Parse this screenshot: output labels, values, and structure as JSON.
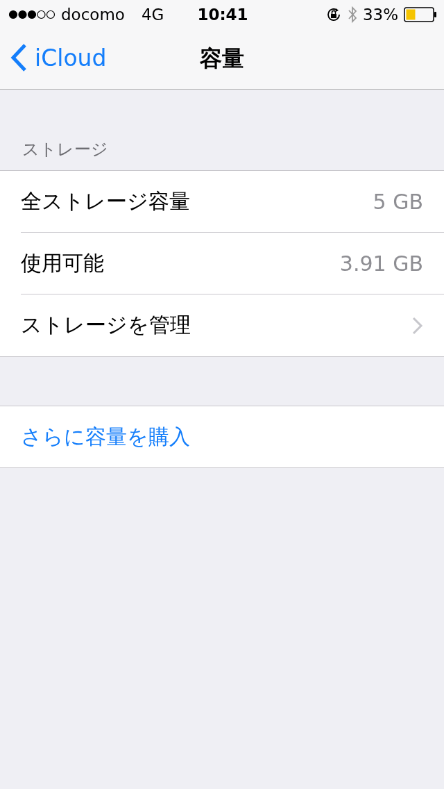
{
  "status_bar": {
    "carrier": "docomo",
    "network": "4G",
    "time": "10:41",
    "battery_percent": "33%"
  },
  "nav": {
    "back": "iCloud",
    "title": "容量"
  },
  "section": {
    "header": "ストレージ",
    "rows": [
      {
        "kind": "value",
        "label": "全ストレージ容量",
        "value": "5 GB"
      },
      {
        "kind": "value",
        "label": "使用可能",
        "value": "3.91 GB"
      },
      {
        "kind": "link",
        "label": "ストレージを管理"
      }
    ]
  },
  "action": "さらに容量を購入"
}
